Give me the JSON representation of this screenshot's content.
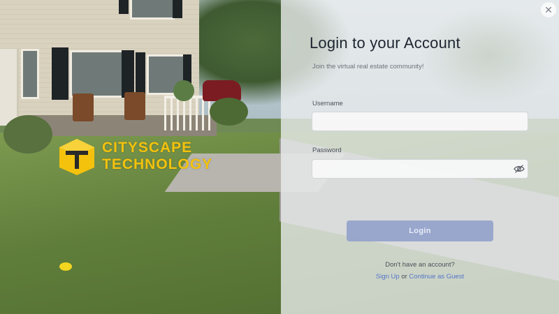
{
  "window": {
    "close_icon": "close-icon"
  },
  "brand": {
    "line1": "CITYSCAPE",
    "line2": "TECHNOLOGY",
    "color": "#f4c20d"
  },
  "login": {
    "title": "Login to your Account",
    "subtitle": "Join the virtual real estate community!",
    "username_label": "Username",
    "username_value": "",
    "password_label": "Password",
    "password_value": "",
    "password_toggle_icon": "eye-slash-icon",
    "submit_label": "Login",
    "no_account_text": "Don't have an account?",
    "signup_link": "Sign Up",
    "or_text": "or",
    "guest_link": "Continue as Guest"
  },
  "colors": {
    "accent": "#5675c9",
    "button": "#96a3cc",
    "panel": "#eceef0"
  }
}
